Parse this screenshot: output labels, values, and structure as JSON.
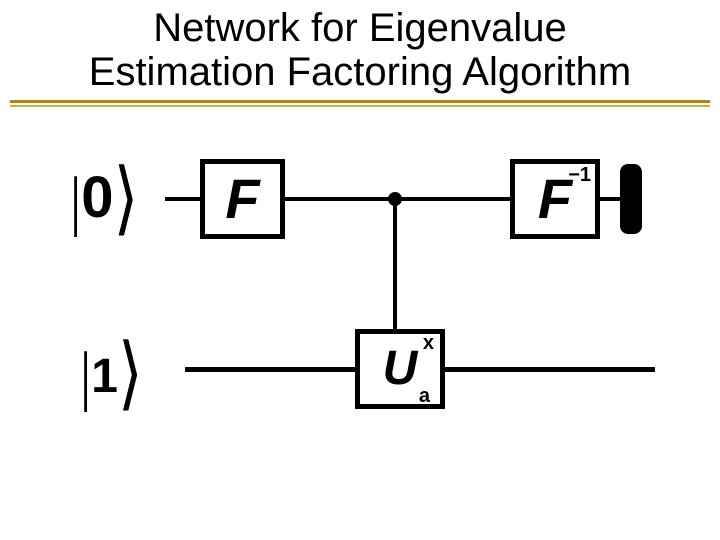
{
  "title_line1": "Network for Eigenvalue",
  "title_line2": "Estimation Factoring Algorithm",
  "ket0_pipe": "|",
  "ket0_val": "0",
  "ket0_angle": "⟩",
  "ket1_pipe": "|",
  "ket1_val": "1",
  "ket1_angle": "⟩",
  "gateF": "F",
  "gateFinv": "F",
  "gateFinv_exp": "−1",
  "gateU": "U",
  "gateU_sup": "x",
  "gateU_sub": "a"
}
